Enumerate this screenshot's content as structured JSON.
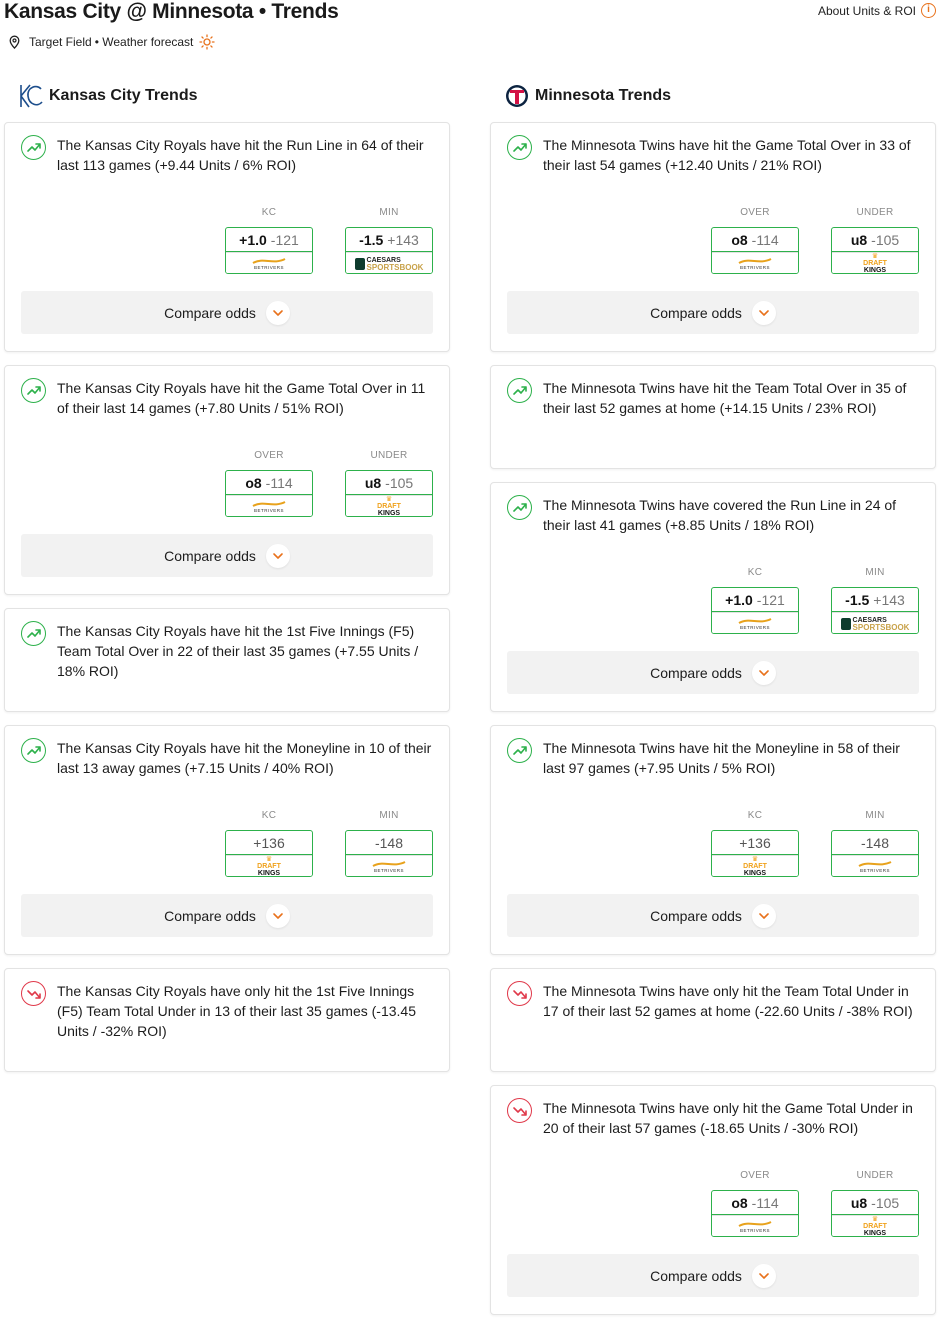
{
  "header": {
    "title": "Kansas City @ Minnesota • Trends",
    "about_label": "About Units & ROI",
    "venue": "Target Field",
    "weather_label": "• Weather forecast"
  },
  "compare_label": "Compare odds",
  "colors": {
    "accent": "#e8721c",
    "up": "#2db14b",
    "down": "#e0394a",
    "odds_border": "#2db14b"
  },
  "left": {
    "title": "Kansas City Trends",
    "logo": "kc-royals-logo",
    "cards": [
      {
        "dir": "up",
        "text": "The Kansas City Royals have hit the Run Line in 64 of their last 113 games (+9.44 Units / 6% ROI)",
        "odds": [
          {
            "label": "KC",
            "line": "+1.0",
            "price": "-121",
            "book": "betrivers"
          },
          {
            "label": "MIN",
            "line": "-1.5",
            "price": "+143",
            "book": "caesars"
          }
        ]
      },
      {
        "dir": "up",
        "text": "The Kansas City Royals have hit the Game Total Over in 11 of their last 14 games (+7.80 Units / 51% ROI)",
        "odds": [
          {
            "label": "OVER",
            "line": "o8",
            "price": "-114",
            "book": "betrivers"
          },
          {
            "label": "UNDER",
            "line": "u8",
            "price": "-105",
            "book": "draftkings"
          }
        ]
      },
      {
        "dir": "up",
        "text": "The Kansas City Royals have hit the 1st Five Innings (F5) Team Total Over in 22 of their last 35 games (+7.55 Units / 18% ROI)"
      },
      {
        "dir": "up",
        "text": "The Kansas City Royals have hit the Moneyline in 10 of their last 13 away games (+7.15 Units / 40% ROI)",
        "odds": [
          {
            "label": "KC",
            "solo": "+136",
            "book": "draftkings"
          },
          {
            "label": "MIN",
            "solo": "-148",
            "book": "betrivers"
          }
        ]
      },
      {
        "dir": "down",
        "text": "The Kansas City Royals have only hit the 1st Five Innings (F5) Team Total Under in 13 of their last 35 games (-13.45 Units / -32% ROI)"
      }
    ]
  },
  "right": {
    "title": "Minnesota Trends",
    "logo": "min-twins-logo",
    "cards": [
      {
        "dir": "up",
        "text": "The Minnesota Twins have hit the Game Total Over in 33 of their last 54 games (+12.40 Units / 21% ROI)",
        "odds": [
          {
            "label": "OVER",
            "line": "o8",
            "price": "-114",
            "book": "betrivers"
          },
          {
            "label": "UNDER",
            "line": "u8",
            "price": "-105",
            "book": "draftkings"
          }
        ]
      },
      {
        "dir": "up",
        "text": "The Minnesota Twins have hit the Team Total Over in 35 of their last 52 games at home (+14.15 Units / 23% ROI)"
      },
      {
        "dir": "up",
        "text": "The Minnesota Twins have covered the Run Line in 24 of their last 41 games (+8.85 Units / 18% ROI)",
        "odds": [
          {
            "label": "KC",
            "line": "+1.0",
            "price": "-121",
            "book": "betrivers"
          },
          {
            "label": "MIN",
            "line": "-1.5",
            "price": "+143",
            "book": "caesars"
          }
        ]
      },
      {
        "dir": "up",
        "text": "The Minnesota Twins have hit the Moneyline in 58 of their last 97 games (+7.95 Units / 5% ROI)",
        "odds": [
          {
            "label": "KC",
            "solo": "+136",
            "book": "draftkings"
          },
          {
            "label": "MIN",
            "solo": "-148",
            "book": "betrivers"
          }
        ]
      },
      {
        "dir": "down",
        "text": "The Minnesota Twins have only hit the Team Total Under in 17 of their last 52 games at home (-22.60 Units / -38% ROI)"
      },
      {
        "dir": "down",
        "text": "The Minnesota Twins have only hit the Game Total Under in 20 of their last 57 games (-18.65 Units / -30% ROI)",
        "odds": [
          {
            "label": "OVER",
            "line": "o8",
            "price": "-114",
            "book": "betrivers"
          },
          {
            "label": "UNDER",
            "line": "u8",
            "price": "-105",
            "book": "draftkings"
          }
        ]
      }
    ]
  },
  "books": {
    "betrivers": {
      "name": "BETRIVERS",
      "color": "#e8a21c"
    },
    "caesars": {
      "line1": "CAESARS",
      "line2": "SPORTSBOOK",
      "color": "#c8a24a"
    },
    "draftkings": {
      "line1": "DRAFT",
      "line2": "KINGS",
      "color": "#f0a21c"
    }
  }
}
